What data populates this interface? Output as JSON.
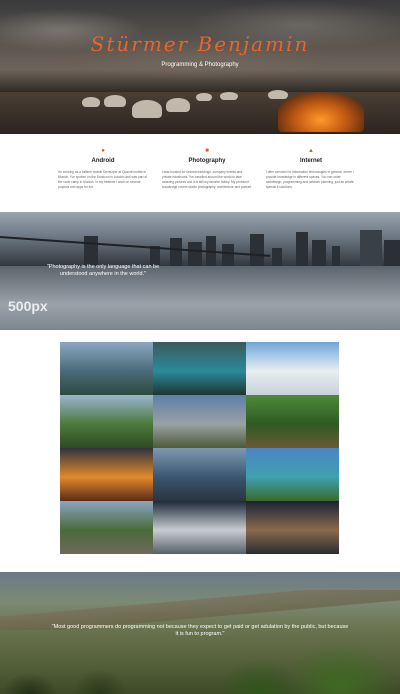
{
  "hero": {
    "title": "Stürmer Benjamin",
    "subtitle": "Programming & Photography"
  },
  "skills": [
    {
      "icon": "android-icon",
      "title": "Android",
      "text": "I'm working as a fulltime mobile Developer at Quandt mobile in Munich. I've spoken on the Droidcon in London and was part of the code camp in Munich. In my freetime I work on several projects and apps for fun."
    },
    {
      "icon": "camera-icon",
      "title": "Photography",
      "text": "I was booked for several weddings, company events and private fotoshoots. I've travelled around the world to take amazing pictures and it is still my favorite hobby. My profound knowledge covers studio photography, architecture and portrait."
    },
    {
      "icon": "globe-icon",
      "title": "Internet",
      "text": "I offer services for information technologies in general, where I provide knowledge in different spaces. You can order webdesign, programming and network planning, just as create special it solutions."
    }
  ],
  "city_quote": "\"Photography is the only language that can be understood anywhere in the world.\"",
  "brand_500px": "500px",
  "gallery": [
    {
      "name": "gallery-photo-coast",
      "colors": [
        "#8aa8c2",
        "#4a6b7a",
        "#2d4a3c"
      ]
    },
    {
      "name": "gallery-photo-cave",
      "colors": [
        "#3a5a5a",
        "#2b8a9a",
        "#1e3530"
      ]
    },
    {
      "name": "gallery-photo-canopy",
      "colors": [
        "#6fa6d8",
        "#e8eef2",
        "#c8d2d8"
      ]
    },
    {
      "name": "gallery-photo-castle",
      "colors": [
        "#9ab4d0",
        "#4c7a3a",
        "#2f4a24"
      ]
    },
    {
      "name": "gallery-photo-palm-road",
      "colors": [
        "#5d7fa8",
        "#9aa1a4",
        "#4d5a3a"
      ]
    },
    {
      "name": "gallery-photo-forest",
      "colors": [
        "#4f8a3a",
        "#2e5a22",
        "#6b5a34"
      ]
    },
    {
      "name": "gallery-photo-sunset",
      "colors": [
        "#2f3340",
        "#e2892b",
        "#5a2c1a"
      ]
    },
    {
      "name": "gallery-photo-sea-rocks",
      "colors": [
        "#7f98b2",
        "#3a5670",
        "#2a3440"
      ]
    },
    {
      "name": "gallery-photo-lagoon",
      "colors": [
        "#4a86c4",
        "#3fa0b0",
        "#3a6a2a"
      ]
    },
    {
      "name": "gallery-photo-tree",
      "colors": [
        "#8aa6c0",
        "#4a6a3a",
        "#6e6a5c"
      ]
    },
    {
      "name": "gallery-photo-grass",
      "colors": [
        "#1e2a3a",
        "#c8ccd0",
        "#596068"
      ]
    },
    {
      "name": "gallery-photo-wedding",
      "colors": [
        "#1b2236",
        "#8a6a4a",
        "#2a2a34"
      ]
    }
  ],
  "mountain_quote": "\"Most good programmers do programming not because they expect to get paid or get adulation by the public, but because it is fun to program.\""
}
